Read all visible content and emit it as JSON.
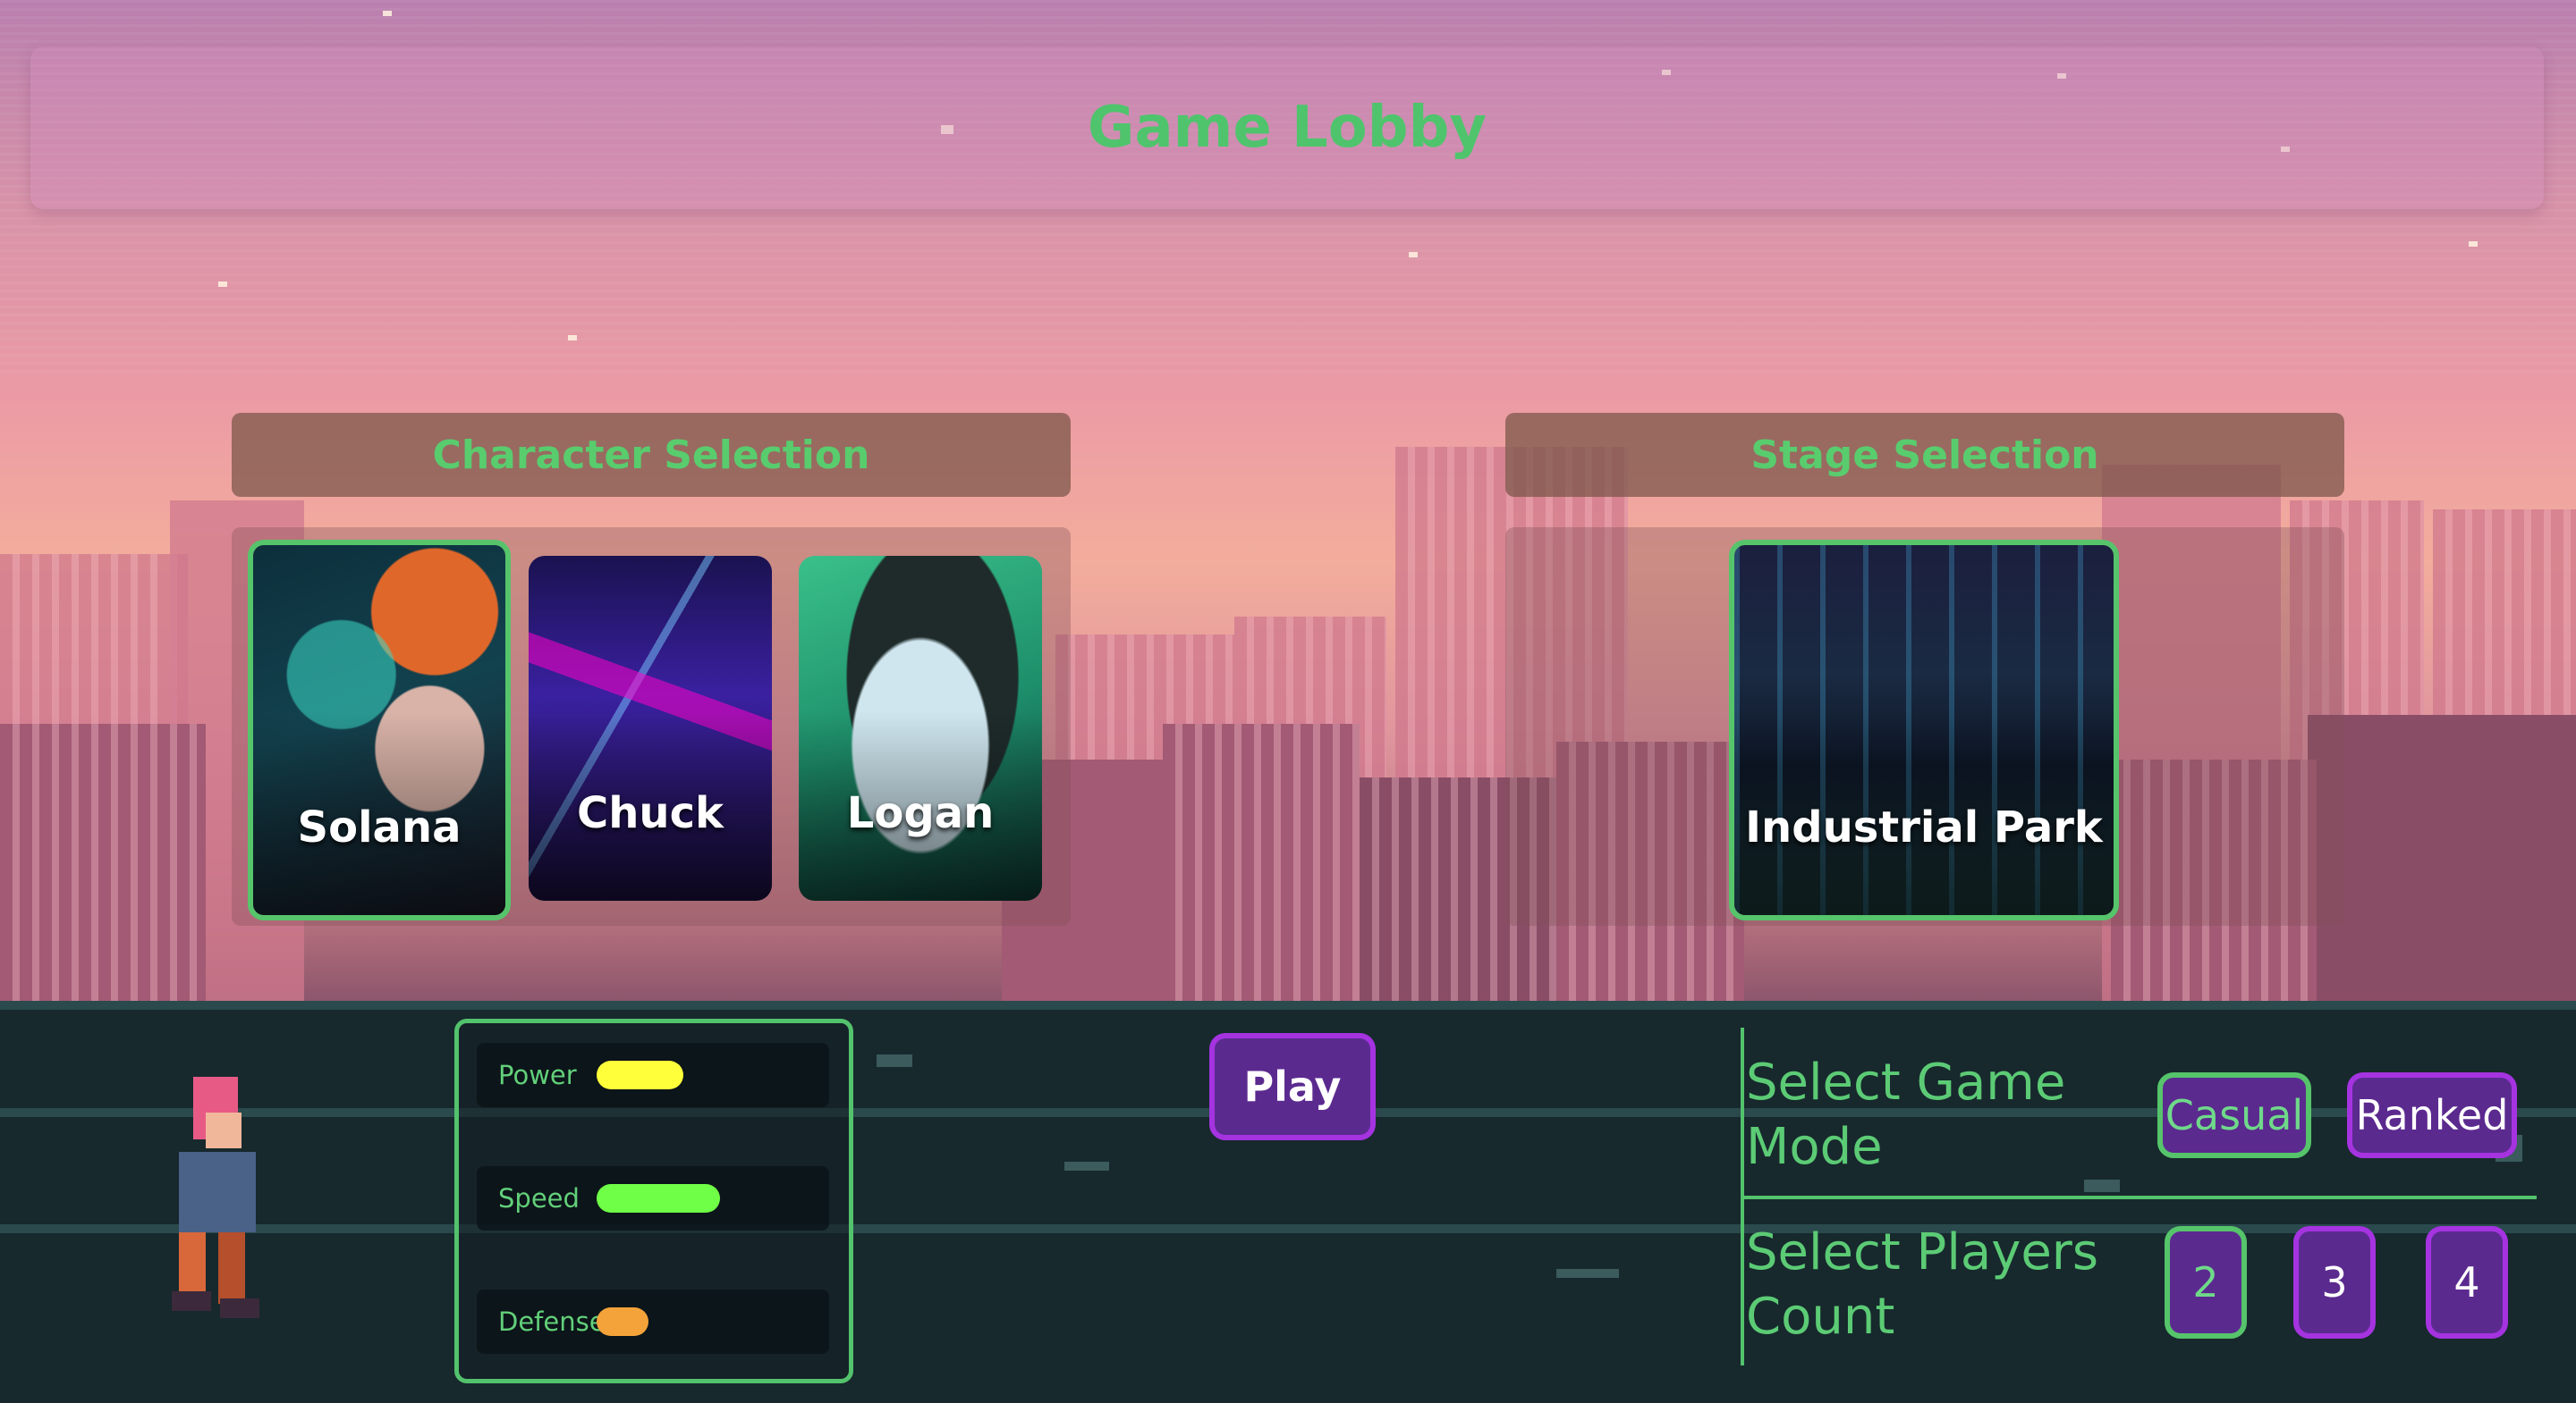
{
  "header": {
    "title": "Game Lobby"
  },
  "character_selection": {
    "title": "Character Selection",
    "characters": [
      {
        "name": "Solana",
        "selected": true
      },
      {
        "name": "Chuck",
        "selected": false
      },
      {
        "name": "Logan",
        "selected": false
      }
    ]
  },
  "stage_selection": {
    "title": "Stage Selection",
    "stages": [
      {
        "name": "Industrial Park",
        "selected": true
      }
    ]
  },
  "stats": {
    "items": [
      {
        "label": "Power",
        "color": "#ffff3a",
        "level": 0.42
      },
      {
        "label": "Speed",
        "color": "#6fff46",
        "level": 0.6
      },
      {
        "label": "Defense",
        "color": "#f4a33a",
        "level": 0.25
      }
    ]
  },
  "play": {
    "label": "Play"
  },
  "game_mode": {
    "label": "Select Game Mode",
    "options": [
      "Casual",
      "Ranked"
    ],
    "selected": "Casual"
  },
  "players_count": {
    "label": "Select Players Count",
    "options": [
      "2",
      "3",
      "4"
    ],
    "selected": "2"
  },
  "colors": {
    "accent_green": "#56c46b",
    "accent_purple": "#a533e0",
    "button_fill": "#5b2a8f"
  }
}
